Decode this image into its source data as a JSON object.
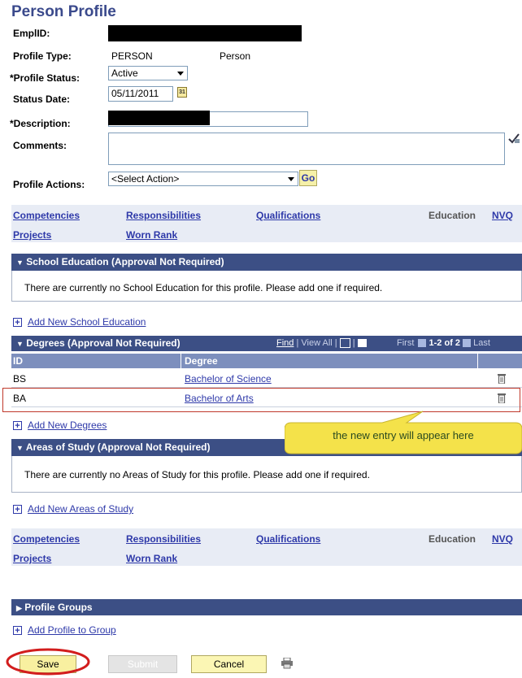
{
  "page": {
    "title": "Person Profile"
  },
  "form": {
    "emplid_label": "EmplID:",
    "profile_type_label": "Profile Type:",
    "profile_type_code": "PERSON",
    "profile_type_desc": "Person",
    "profile_status_label": "*Profile Status:",
    "profile_status_value": "Active",
    "status_date_label": "Status Date:",
    "status_date_value": "05/11/2011",
    "description_label": "*Description:",
    "comments_label": "Comments:",
    "profile_actions_label": "Profile Actions:",
    "profile_actions_value": "<Select Action>",
    "go_label": "Go"
  },
  "nav_links": {
    "row1": [
      "Competencies",
      "Responsibilities",
      "Qualifications",
      "Education",
      "NVQ"
    ],
    "row2": [
      "Projects",
      "Worn Rank"
    ]
  },
  "school_education": {
    "header": "School Education (Approval Not Required)",
    "message": "There are currently no School Education for this profile.  Please add one if required.",
    "add_link": "Add New School Education"
  },
  "degrees": {
    "header": "Degrees (Approval Not Required)",
    "find": "Find",
    "view_all": "View All",
    "first": "First",
    "range": "1-2 of 2",
    "last": "Last",
    "columns": [
      "ID",
      "Degree"
    ],
    "rows": [
      {
        "id": "BS",
        "degree": "Bachelor of Science"
      },
      {
        "id": "BA",
        "degree": "Bachelor of Arts"
      }
    ],
    "add_link": "Add New Degrees"
  },
  "callout": {
    "text": "the new entry will appear here"
  },
  "areas_of_study": {
    "header": "Areas of Study (Approval Not Required)",
    "message": "There are currently no Areas of Study for this profile.  Please add one if required.",
    "add_link": "Add New Areas of Study"
  },
  "profile_groups": {
    "header": "Profile Groups",
    "add_link": "Add Profile to Group"
  },
  "buttons": {
    "save": "Save",
    "submit": "Submit",
    "cancel": "Cancel"
  }
}
